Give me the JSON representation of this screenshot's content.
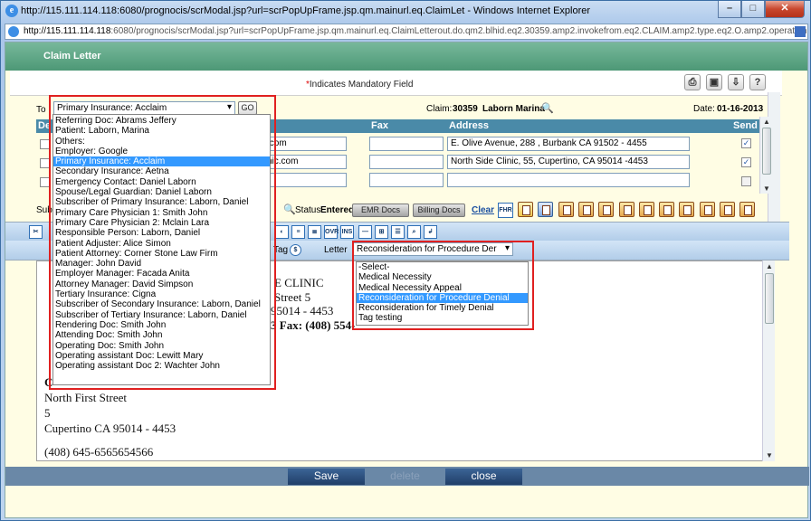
{
  "window": {
    "title": "http://115.111.114.118:6080/prognocis/scrModal.jsp?url=scrPopUpFrame.jsp.qm.mainurl.eq.ClaimLet - Windows Internet Explorer",
    "address_host": "http://115.111.114.118",
    "address_rest": ":6080/prognocis/scrModal.jsp?url=scrPopUpFrame.jsp.qm.mainurl.eq.ClaimLetterout.do.qm2.blhid.eq2.30359.amp2.invokefrom.eq2.CLAIM.amp2.type.eq2.O.amp2.operation.eq2."
  },
  "header": {
    "title": "Claim Letter",
    "mandatory_note": "Indicates Mandatory Field",
    "mandatory_mark": "*"
  },
  "toolbar_icons": [
    "print-icon",
    "save-icon",
    "export-icon",
    "help-icon"
  ],
  "help_label": "?",
  "to": {
    "label": "To",
    "selected": "Primary Insurance: Acclaim",
    "go_label": "GO"
  },
  "claim": {
    "label": "Claim:",
    "number": "30359",
    "patient": "Laborn Marina"
  },
  "date": {
    "label": "Date:",
    "value": "01-16-2013"
  },
  "recipients_table": {
    "col_partial": "De",
    "columns": [
      "Fax",
      "Address",
      "Send"
    ],
    "rows": [
      {
        "email_tail": ".com",
        "fax": "",
        "address": "E. Olive Avenue, 288 , Burbank CA 91502 - 4455",
        "send": "checked"
      },
      {
        "email_tail": "nic.com",
        "fax": "",
        "address": "North Side Clinic, 55, Cupertino, CA 95014 -4453",
        "send": "checked"
      },
      {
        "email_tail": "",
        "fax": "",
        "address": "",
        "send": "unchecked"
      }
    ]
  },
  "subject_label_partial": "Sub",
  "status": {
    "label": "Status",
    "value": "Entered"
  },
  "buttons": {
    "emr_docs": "EMR Docs",
    "billing_docs": "Billing Docs",
    "clear": "Clear",
    "fhr": "FHR"
  },
  "editor_toolbar": {
    "tag_label": "Tag",
    "letter_label": "Letter",
    "letter_selected": "Reconsideration for Procedure Der",
    "tag_dollar": "$",
    "ovr": "OVR",
    "ins": "INS"
  },
  "letter_options": [
    "-Select-",
    "Medical Necessity",
    "Medical Necessity Appeal",
    "Reconsideration for Procedure Denial",
    "Reconsideration for Timely Denial",
    "Tag testing"
  ],
  "letter_selected_index": 3,
  "to_options": [
    "Referring Doc: Abrams Jeffery",
    "Patient: Laborn, Marina",
    "Others:",
    "Employer: Google",
    "Primary Insurance: Acclaim",
    "Secondary Insurance: Aetna",
    "Emergency Contact: Daniel Laborn",
    "Spouse/Legal Guardian: Daniel Laborn",
    "Subscriber of Primary Insurance: Laborn, Daniel",
    "Primary Care Physician 1: Smith John",
    "Primary Care Physician 2: Mclain Lara",
    "Responsible Person: Laborn, Daniel",
    "Patient Adjuster: Alice Simon",
    "Patient Attorney: Corner Stone Law Firm",
    "Manager: John David",
    "Employer Manager: Facada Anita",
    "Attorney Manager: David Simpson",
    "Tertiary Insurance: Cigna",
    "Subscriber of Secondary Insurance: Laborn, Daniel",
    "Subscriber of Tertiary Insurance: Laborn, Daniel",
    "Rendering Doc: Smith John",
    "Attending Doc: Smith John",
    "Operating Doc: Smith John",
    "Operating assistant Doc: Lewitt Mary",
    "Operating assistant Doc 2: Wachter John"
  ],
  "to_selected_index": 4,
  "letter_body": {
    "partial_lines": [
      "E CLINIC",
      "Street 5",
      "95014 - 4453",
      "Fax: (408) 554-"
    ],
    "partial_fax_prefix": "3 ",
    "lines": [
      "C",
      "North First Street",
      "5",
      "Cupertino CA 95014 - 4453",
      "",
      "(408) 645-6565654566"
    ]
  },
  "footer": {
    "save": "Save",
    "delete": "delete",
    "close": "close"
  }
}
